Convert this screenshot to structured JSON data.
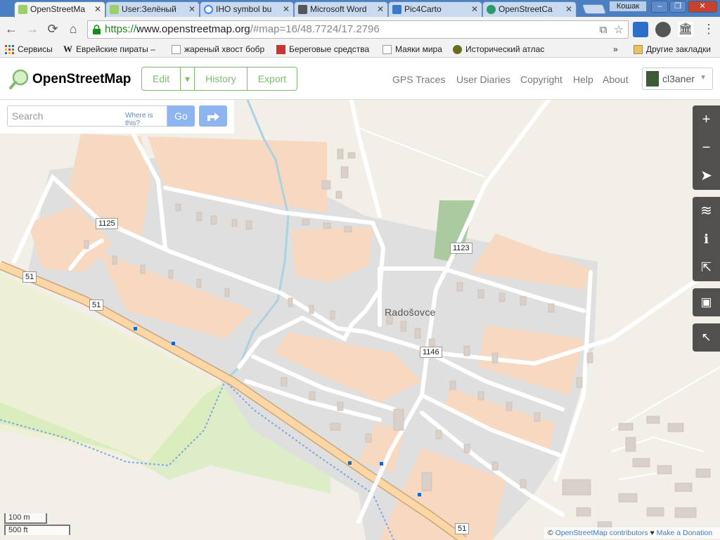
{
  "browser": {
    "tabs": [
      {
        "title": "OpenStreetMa",
        "active": true
      },
      {
        "title": "User:Зелёный",
        "active": false
      },
      {
        "title": "IHO symbol bu",
        "active": false
      },
      {
        "title": "Microsoft Word",
        "active": false
      },
      {
        "title": "Pic4Carto",
        "active": false
      },
      {
        "title": "OpenStreetCa",
        "active": false
      }
    ],
    "window_user": "Кошак",
    "url_scheme": "https://",
    "url_host": "www.openstreetmap.org",
    "url_path": "/#map=16/48.7724/17.2796",
    "bookmarks": [
      {
        "label": "Сервисы"
      },
      {
        "label": "Еврейские пираты –"
      },
      {
        "label": "жареный хвост бобр"
      },
      {
        "label": "Береговые средства"
      },
      {
        "label": "Маяки мира"
      },
      {
        "label": "Исторический атлас"
      }
    ],
    "bookmarks_more": "»",
    "other_bookmarks": "Другие закладки"
  },
  "header": {
    "site_title": "OpenStreetMap",
    "edit_label": "Edit",
    "history_label": "History",
    "export_label": "Export",
    "nav": [
      "GPS Traces",
      "User Diaries",
      "Copyright",
      "Help",
      "About"
    ],
    "username": "cl3aner"
  },
  "search": {
    "placeholder": "Search",
    "where_label": "Where is this?",
    "go_label": "Go"
  },
  "map": {
    "place_name": "Radošovce",
    "road_refs": [
      {
        "label": "1125"
      },
      {
        "label": "1123"
      },
      {
        "label": "1146"
      },
      {
        "label": "51"
      },
      {
        "label": "51"
      },
      {
        "label": "51"
      }
    ],
    "scale_metric": "100 m",
    "scale_imperial": "500 ft",
    "attribution_prefix": "©",
    "attribution_link": "OpenStreetMap contributors",
    "donate_link": "Make a Donation"
  },
  "colors": {
    "osm_green": "#7ebc6f",
    "residential": "#e0dfdf",
    "farmland": "#f7d9c1",
    "primary_road": "#fcd6a4",
    "grass": "#cdebb0",
    "water": "#aad3df",
    "control_bg": "#333333"
  }
}
